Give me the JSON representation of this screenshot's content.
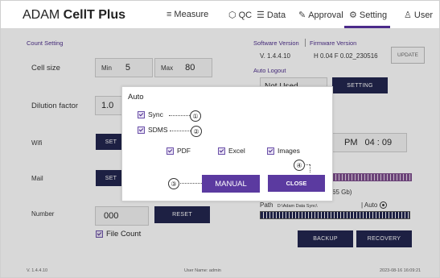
{
  "app": {
    "title_light": "ADAM ",
    "title_bold": "CellT Plus"
  },
  "nav": [
    {
      "icon": "≡",
      "label": "Measure"
    },
    {
      "icon": "⬡",
      "label": "QC"
    },
    {
      "icon": "☰",
      "label": "Data"
    },
    {
      "icon": "✎",
      "label": "Approval"
    },
    {
      "icon": "⚙",
      "label": "Setting"
    },
    {
      "icon": "♙",
      "label": "User"
    }
  ],
  "count_setting": {
    "title": "Count Setting",
    "cell_size_label": "Cell size",
    "min_label": "Min",
    "min_value": "5",
    "max_label": "Max",
    "max_value": "80",
    "dilution_label": "Dilution factor",
    "dilution_value": "1.0"
  },
  "wifi": {
    "label": "Wifi",
    "button": "SET"
  },
  "mail": {
    "label": "Mail",
    "button": "SET"
  },
  "number": {
    "label": "Number",
    "value": "000",
    "reset": "RESET",
    "file_count": "File Count"
  },
  "version": {
    "software_label": "Software Version",
    "firmware_label": "Firmware Version",
    "software_value": "V. 1.4.4.10",
    "firmware_value": "H 0.04 F 0.02_230516",
    "update": "UPDATE",
    "auto_logout": "Auto Logout",
    "logout_value": "Not Used",
    "setting": "SETTING"
  },
  "time": {
    "ampm": "PM",
    "value": "04 : 09"
  },
  "storage": {
    "size": "65 Gb)",
    "path_label": "Path",
    "path_value": "D:\\Adam Data Sync\\",
    "auto_label": "Auto",
    "backup": "BACKUP",
    "recovery": "RECOVERY"
  },
  "dialog": {
    "title": "Auto",
    "sync": "Sync",
    "sdms": "SDMS",
    "pdf": "PDF",
    "excel": "Excel",
    "images": "Images",
    "manual": "MANUAL",
    "close": "CLOSE",
    "callouts": [
      "①",
      "②",
      "③",
      "④"
    ]
  },
  "footer": {
    "version": "V. 1.4.4.10",
    "user": "User Name: admin",
    "datetime": "2023-08-16 16:09:21"
  }
}
